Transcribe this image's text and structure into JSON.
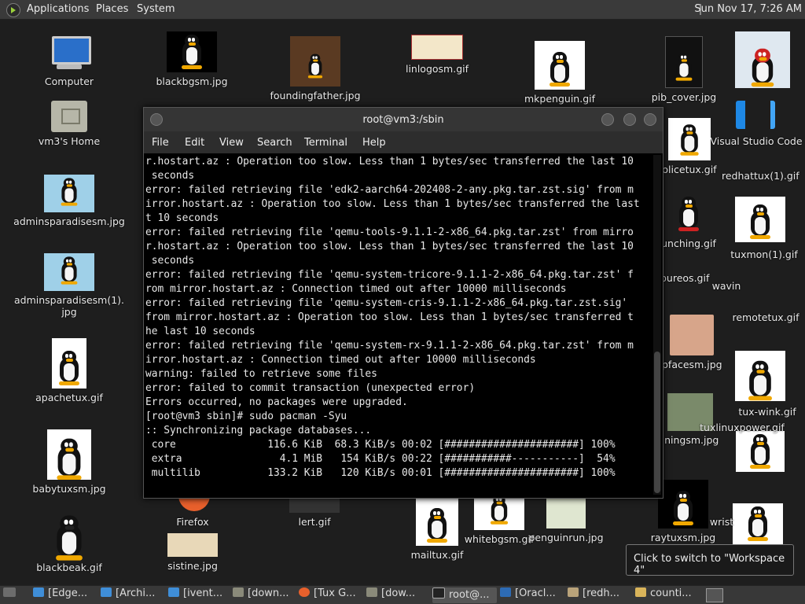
{
  "top_panel": {
    "menus": [
      "Applications",
      "Places",
      "System"
    ],
    "clock": "Sun Nov 17,  7:26 AM"
  },
  "desktop": {
    "icons": [
      {
        "label": "Computer"
      },
      {
        "label": "vm3's Home"
      },
      {
        "label": "adminsparadisesm.jpg"
      },
      {
        "label": "adminsparadisesm(1).",
        "label2": "jpg"
      },
      {
        "label": "apachetux.gif"
      },
      {
        "label": "babytuxsm.jpg"
      },
      {
        "label": "blackbeak.gif"
      },
      {
        "label": "blackbgsm.jpg"
      },
      {
        "label": "foundingfather.jpg"
      },
      {
        "label": "linlogosm.gif"
      },
      {
        "label": "mkpenguin.gif"
      },
      {
        "label": "pib_cover.jpg"
      },
      {
        "label": "Visual Studio Code"
      },
      {
        "label": "Firefox"
      },
      {
        "label": "lert.gif"
      },
      {
        "label": "sistine.jpg"
      },
      {
        "label": "mailtux.gif"
      },
      {
        "label": "whitebgsm.gif"
      },
      {
        "label": "penguinrun.jpg"
      },
      {
        "label": "raytuxsm.jpg"
      },
      {
        "label": "olicetux.gif"
      },
      {
        "label": "unching.gif"
      },
      {
        "label": "pfacesm.jpg"
      },
      {
        "label": "iningsm.jpg"
      },
      {
        "label": "tuxlinuxpower.gif"
      },
      {
        "label": "remotetux.gif"
      },
      {
        "label": "tux-wink.gif"
      },
      {
        "label": "wrist"
      },
      {
        "label": "redhattux(1).gif"
      },
      {
        "label": "tuxmon(1).gif"
      },
      {
        "label": "pureos.gif"
      },
      {
        "label": "wavin"
      }
    ]
  },
  "terminal": {
    "title": "root@vm3:/sbin",
    "menu": [
      "File",
      "Edit",
      "View",
      "Search",
      "Terminal",
      "Help"
    ],
    "lines": [
      "r.hostart.az : Operation too slow. Less than 1 bytes/sec transferred the last 10",
      " seconds",
      "error: failed retrieving file 'edk2-aarch64-202408-2-any.pkg.tar.zst.sig' from m",
      "irror.hostart.az : Operation too slow. Less than 1 bytes/sec transferred the last",
      "t 10 seconds",
      "error: failed retrieving file 'qemu-tools-9.1.1-2-x86_64.pkg.tar.zst' from mirro",
      "r.hostart.az : Operation too slow. Less than 1 bytes/sec transferred the last 10",
      " seconds",
      "error: failed retrieving file 'qemu-system-tricore-9.1.1-2-x86_64.pkg.tar.zst' f",
      "rom mirror.hostart.az : Connection timed out after 10000 milliseconds",
      "error: failed retrieving file 'qemu-system-cris-9.1.1-2-x86_64.pkg.tar.zst.sig'",
      "from mirror.hostart.az : Operation too slow. Less than 1 bytes/sec transferred t",
      "he last 10 seconds",
      "error: failed retrieving file 'qemu-system-rx-9.1.1-2-x86_64.pkg.tar.zst' from m",
      "irror.hostart.az : Connection timed out after 10000 milliseconds",
      "warning: failed to retrieve some files",
      "error: failed to commit transaction (unexpected error)",
      "Errors occurred, no packages were upgraded.",
      "[root@vm3 sbin]# sudo pacman -Syu",
      ":: Synchronizing package databases...",
      " core               116.6 KiB  68.3 KiB/s 00:02 [######################] 100%",
      " extra                4.1 MiB   154 KiB/s 00:22 [###########-----------]  54%",
      " multilib           133.2 KiB   120 KiB/s 00:01 [######################] 100%"
    ]
  },
  "tooltip": "Click to switch to \"Workspace 4\"",
  "taskbar": {
    "items": [
      {
        "label": "[Edge..."
      },
      {
        "label": "[Archi..."
      },
      {
        "label": "[ivent..."
      },
      {
        "label": "[down..."
      },
      {
        "label": "[Tux G..."
      },
      {
        "label": "[dow..."
      },
      {
        "label": "root@..."
      },
      {
        "label": "[Oracl..."
      },
      {
        "label": "[redh..."
      },
      {
        "label": "counti..."
      }
    ]
  }
}
